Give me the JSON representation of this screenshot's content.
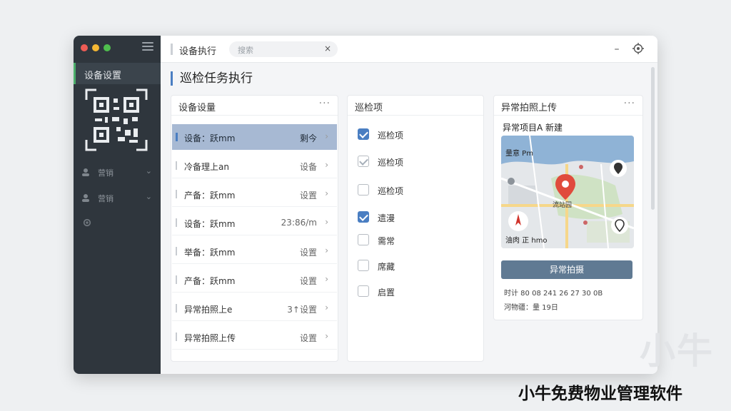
{
  "sidebar": {
    "active_label": "设备设置",
    "items": [
      {
        "label": "营销"
      },
      {
        "label": "营销"
      }
    ]
  },
  "titlebar": {
    "tab_title": "设备执行",
    "search_placeholder": "搜索",
    "clear": "×",
    "icons": [
      "minimize-icon",
      "target-icon",
      "gear-icon",
      "bell-icon",
      "avatar"
    ]
  },
  "page": {
    "title": "巡检任务执行"
  },
  "device_panel": {
    "title": "设备设量",
    "more": "···",
    "rows": [
      {
        "label": "设备：跃mm",
        "value": "剩今"
      },
      {
        "label": "冷备理上an",
        "value": "设备"
      },
      {
        "label": "产备：跃mm",
        "value": "设置"
      },
      {
        "label": "设备：跃mm",
        "value": "23:86/m"
      },
      {
        "label": "举备：跃mm",
        "value": "设置"
      },
      {
        "label": "产备：跃mm",
        "value": "设置"
      },
      {
        "label": "异常拍照上e",
        "value": "3↑设置"
      },
      {
        "label": "异常拍照上传",
        "value": "设置"
      }
    ]
  },
  "checklist_panel": {
    "title": "巡检项",
    "items": [
      {
        "label": "巡检项",
        "state": "checked"
      },
      {
        "label": "巡检项",
        "state": "light"
      },
      {
        "label": "巡检项",
        "state": "empty"
      },
      {
        "label": "遗漫",
        "state": "checked"
      },
      {
        "label": "需常",
        "state": "empty"
      },
      {
        "label": "席藏",
        "state": "empty"
      },
      {
        "label": "启置",
        "state": "empty"
      }
    ]
  },
  "upload_panel": {
    "title": "异常拍照上传",
    "more": "···",
    "subtitle": "异常项目A 新建",
    "map_label_top": "量意 Pm",
    "map_label_mid": "流站园",
    "map_label_bottom": "油肉 正 hmo",
    "button": "异常拍摄",
    "line1": "时计 80 08 241 26 27 30 0B",
    "line2": "河物疆：量 19日"
  },
  "watermark": {
    "big": "小牛",
    "text": "小牛免费物业管理软件"
  },
  "colors": {
    "accent": "#4a7ec2",
    "sidebar_bg": "#2f363d",
    "active_row": "#a7b9d3",
    "button": "#607a93",
    "map_pin": "#e04b3c"
  }
}
